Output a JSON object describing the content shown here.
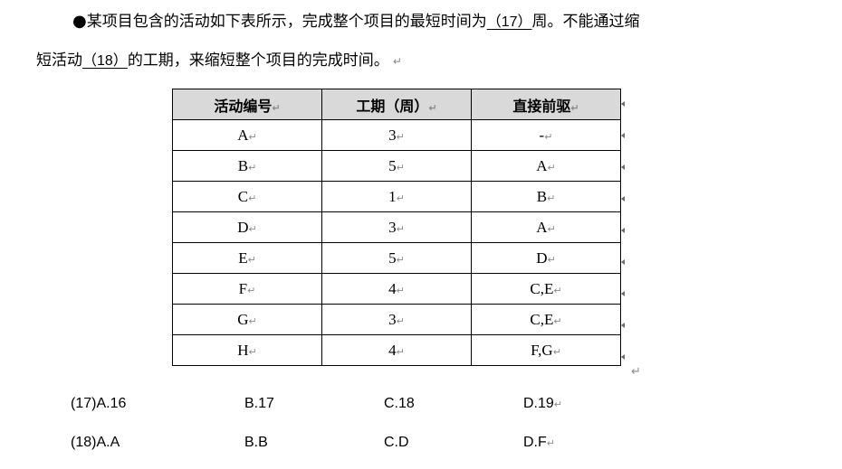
{
  "question": {
    "line1_prefix": "某项目包含的活动如下表所示，完成整个项目的最短时间为",
    "blank17": "（17）",
    "line1_suffix": "周。不能通过缩",
    "line2_prefix": "短活动",
    "blank18": "（18）",
    "line2_suffix": "的工期，来缩短整个项目的完成时间。",
    "bullet": "●",
    "para_mark": "↵"
  },
  "table": {
    "headers": [
      "活动编号",
      "工期（周）",
      "直接前驱"
    ],
    "rows": [
      [
        "A",
        "3",
        "-"
      ],
      [
        "B",
        "5",
        "A"
      ],
      [
        "C",
        "1",
        "B"
      ],
      [
        "D",
        "3",
        "A"
      ],
      [
        "E",
        "5",
        "D"
      ],
      [
        "F",
        "4",
        "C,E"
      ],
      [
        "G",
        "3",
        "C,E"
      ],
      [
        "H",
        "4",
        "F,G"
      ]
    ]
  },
  "options": [
    [
      "(17)A.16",
      "B.17",
      "C.18",
      "D.19"
    ],
    [
      "(18)A.A",
      "B.B",
      "C.D",
      "D.F"
    ]
  ]
}
